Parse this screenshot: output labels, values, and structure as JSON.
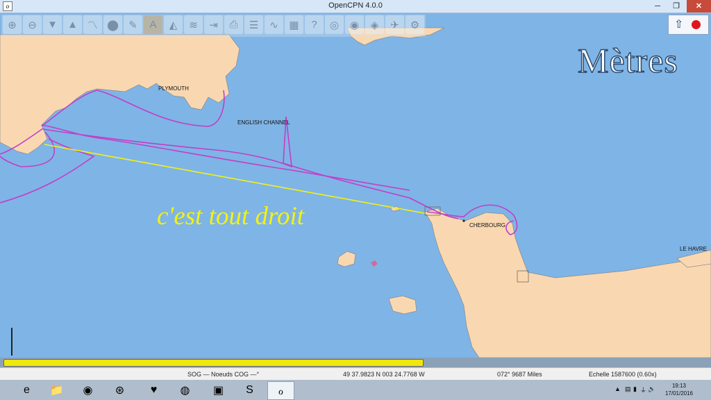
{
  "window": {
    "title": "OpenCPN 4.0.0",
    "app_icon": "o",
    "minimize_glyph": "─",
    "maximize_glyph": "❐",
    "close_glyph": "✕"
  },
  "toolbar": {
    "tools": [
      {
        "icon": "zoom-in-icon",
        "glyph": "⊕"
      },
      {
        "icon": "zoom-out-icon",
        "glyph": "⊖"
      },
      {
        "icon": "scale-in-icon",
        "glyph": "▼"
      },
      {
        "icon": "scale-out-icon",
        "glyph": "▲"
      },
      {
        "icon": "route-icon",
        "glyph": "〽"
      },
      {
        "icon": "waypoint-icon",
        "glyph": "⬤"
      },
      {
        "icon": "measure-icon",
        "glyph": "✎"
      },
      {
        "icon": "auto-follow-icon",
        "glyph": "A"
      },
      {
        "icon": "settings-icon",
        "glyph": "◭"
      },
      {
        "icon": "text-icon",
        "glyph": "≋"
      },
      {
        "icon": "current-icon",
        "glyph": "⇥"
      },
      {
        "icon": "print-icon",
        "glyph": "⎙"
      },
      {
        "icon": "route-manager-icon",
        "glyph": "☰"
      },
      {
        "icon": "track-icon",
        "glyph": "∿"
      },
      {
        "icon": "color-scheme-icon",
        "glyph": "▦"
      },
      {
        "icon": "help-icon",
        "glyph": "?"
      },
      {
        "icon": "ais-icon",
        "glyph": "◎"
      },
      {
        "icon": "mob-icon",
        "glyph": "◉"
      },
      {
        "icon": "tide-icon",
        "glyph": "◈"
      },
      {
        "icon": "plugin-icon",
        "glyph": "✈"
      },
      {
        "icon": "dashboard-icon",
        "glyph": "⚙"
      }
    ],
    "active_index": 7
  },
  "compass": {
    "needle_glyph": "⇧",
    "gps_status": "red"
  },
  "map": {
    "units_label": "Mètres",
    "places": {
      "plymouth": "PLYMOUTH",
      "english_channel": "ENGLISH CHANNEL",
      "cherbourg": "CHERBOURG",
      "le_havre": "LE HAVRE"
    },
    "annotation": "c'est tout droit",
    "colors": {
      "sea": "#7fb4e6",
      "land": "#f9d8b1",
      "track": "#c23ec7",
      "route": "#f4f20f",
      "annotation": "#f4f20f"
    }
  },
  "progress": {
    "fraction": 0.595
  },
  "status": {
    "sog_cog": "SOG — Noeuds COG —°",
    "position": "49 37.9823 N   003 24.7768 W",
    "bearing": "072°  9687 Miles",
    "scale": "Echelle 1587600 (0.60x)"
  },
  "taskbar": {
    "apps": [
      {
        "name": "ie-icon",
        "glyph": "e"
      },
      {
        "name": "file-explorer-icon",
        "glyph": "📁"
      },
      {
        "name": "app-circle-icon",
        "glyph": "◉"
      },
      {
        "name": "compass-app-icon",
        "glyph": "⊛"
      },
      {
        "name": "heart-app-icon",
        "glyph": "♥"
      },
      {
        "name": "chrome-icon",
        "glyph": "◍"
      },
      {
        "name": "network-app-icon",
        "glyph": "▣"
      },
      {
        "name": "skype-icon",
        "glyph": "S"
      },
      {
        "name": "opencpn-taskbar-icon",
        "glyph": "ℴ"
      }
    ],
    "tray_glyphs": [
      "▲",
      "▤",
      "▮",
      "⏚",
      "🔊"
    ],
    "time": "19:13",
    "date": "17/01/2016"
  }
}
